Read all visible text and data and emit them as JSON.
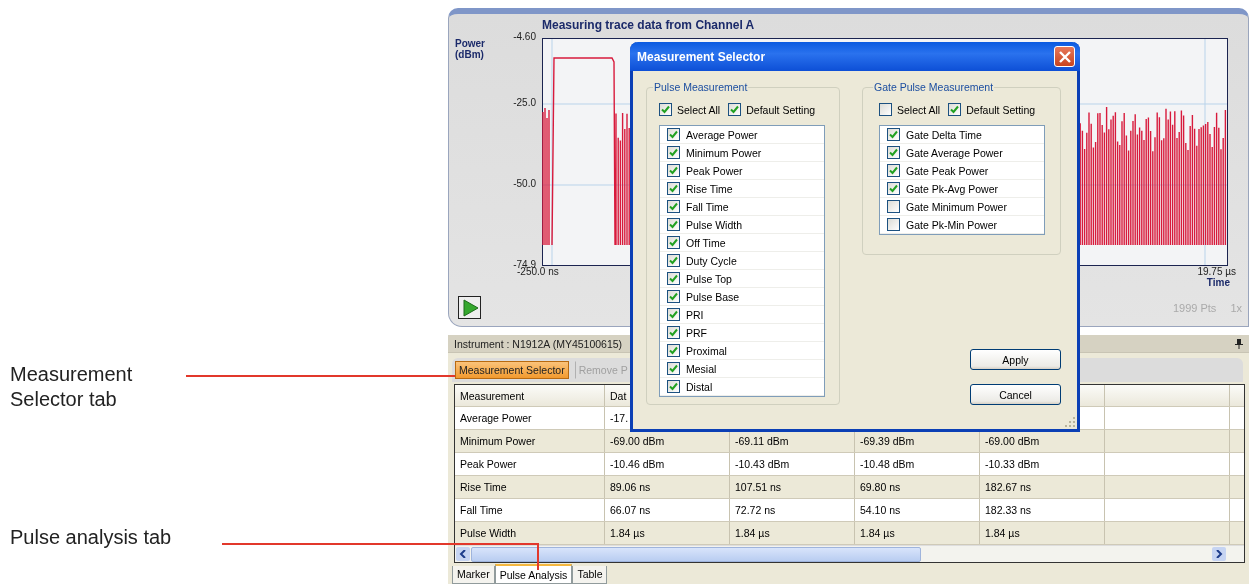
{
  "callouts": [
    {
      "text": "Measurement Selector tab"
    },
    {
      "text": "Pulse analysis tab"
    }
  ],
  "chart_panel": {
    "title": "Measuring trace data from Channel A",
    "y_label": "Power (dBm)",
    "y_ticks": [
      "-4.60",
      "-25.0",
      "-50.0",
      "-74.9"
    ],
    "x_start": "-250.0 ns",
    "x_end": "19.75 µs",
    "x_label": "Time",
    "points": "1999 Pts",
    "zoom": "1x"
  },
  "instrument_bar": {
    "text": "Instrument : N1912A (MY45100615)"
  },
  "toolbar": [
    {
      "label": "Measurement Selector",
      "selected": true,
      "disabled": false
    },
    {
      "label": "Remove P",
      "selected": false,
      "disabled": true
    }
  ],
  "table": {
    "columns": [
      "Measurement",
      "Dat"
    ],
    "rows": [
      [
        "Average Power",
        "-17."
      ],
      [
        "Minimum Power",
        "-69.00 dBm",
        "-69.11 dBm",
        "-69.39 dBm",
        "-69.00 dBm"
      ],
      [
        "Peak Power",
        "-10.46 dBm",
        "-10.43 dBm",
        "-10.48 dBm",
        "-10.33 dBm"
      ],
      [
        "Rise Time",
        "89.06 ns",
        "107.51 ns",
        "69.80 ns",
        "182.67 ns"
      ],
      [
        "Fall Time",
        "66.07 ns",
        "72.72 ns",
        "54.10 ns",
        "182.33 ns"
      ],
      [
        "Pulse Width",
        "1.84 µs",
        "1.84 µs",
        "1.84 µs",
        "1.84 µs"
      ]
    ]
  },
  "tabs": [
    {
      "label": "Marker",
      "selected": false
    },
    {
      "label": "Pulse Analysis",
      "selected": true
    },
    {
      "label": "Table",
      "selected": false
    }
  ],
  "dialog": {
    "title": "Measurement Selector",
    "groups": [
      {
        "legend": "Pulse Measurement",
        "select_all": {
          "label": "Select All",
          "checked": true
        },
        "default_setting": {
          "label": "Default Setting",
          "checked": true
        },
        "items": [
          {
            "label": "Average Power",
            "checked": true
          },
          {
            "label": "Minimum Power",
            "checked": true
          },
          {
            "label": "Peak Power",
            "checked": true
          },
          {
            "label": "Rise Time",
            "checked": true
          },
          {
            "label": "Fall Time",
            "checked": true
          },
          {
            "label": "Pulse Width",
            "checked": true
          },
          {
            "label": "Off Time",
            "checked": true
          },
          {
            "label": "Duty Cycle",
            "checked": true
          },
          {
            "label": "Pulse Top",
            "checked": true
          },
          {
            "label": "Pulse Base",
            "checked": true
          },
          {
            "label": "PRI",
            "checked": true
          },
          {
            "label": "PRF",
            "checked": true
          },
          {
            "label": "Proximal",
            "checked": true
          },
          {
            "label": "Mesial",
            "checked": true
          },
          {
            "label": "Distal",
            "checked": true
          }
        ]
      },
      {
        "legend": "Gate Pulse Measurement",
        "select_all": {
          "label": "Select All",
          "checked": false
        },
        "default_setting": {
          "label": "Default Setting",
          "checked": true
        },
        "items": [
          {
            "label": "Gate Delta Time",
            "checked": true
          },
          {
            "label": "Gate Average Power",
            "checked": true
          },
          {
            "label": "Gate Peak Power",
            "checked": true
          },
          {
            "label": "Gate Pk-Avg Power",
            "checked": true
          },
          {
            "label": "Gate Minimum Power",
            "checked": false
          },
          {
            "label": "Gate Pk-Min Power",
            "checked": false
          }
        ]
      }
    ],
    "buttons": [
      "Apply",
      "Cancel"
    ]
  }
}
